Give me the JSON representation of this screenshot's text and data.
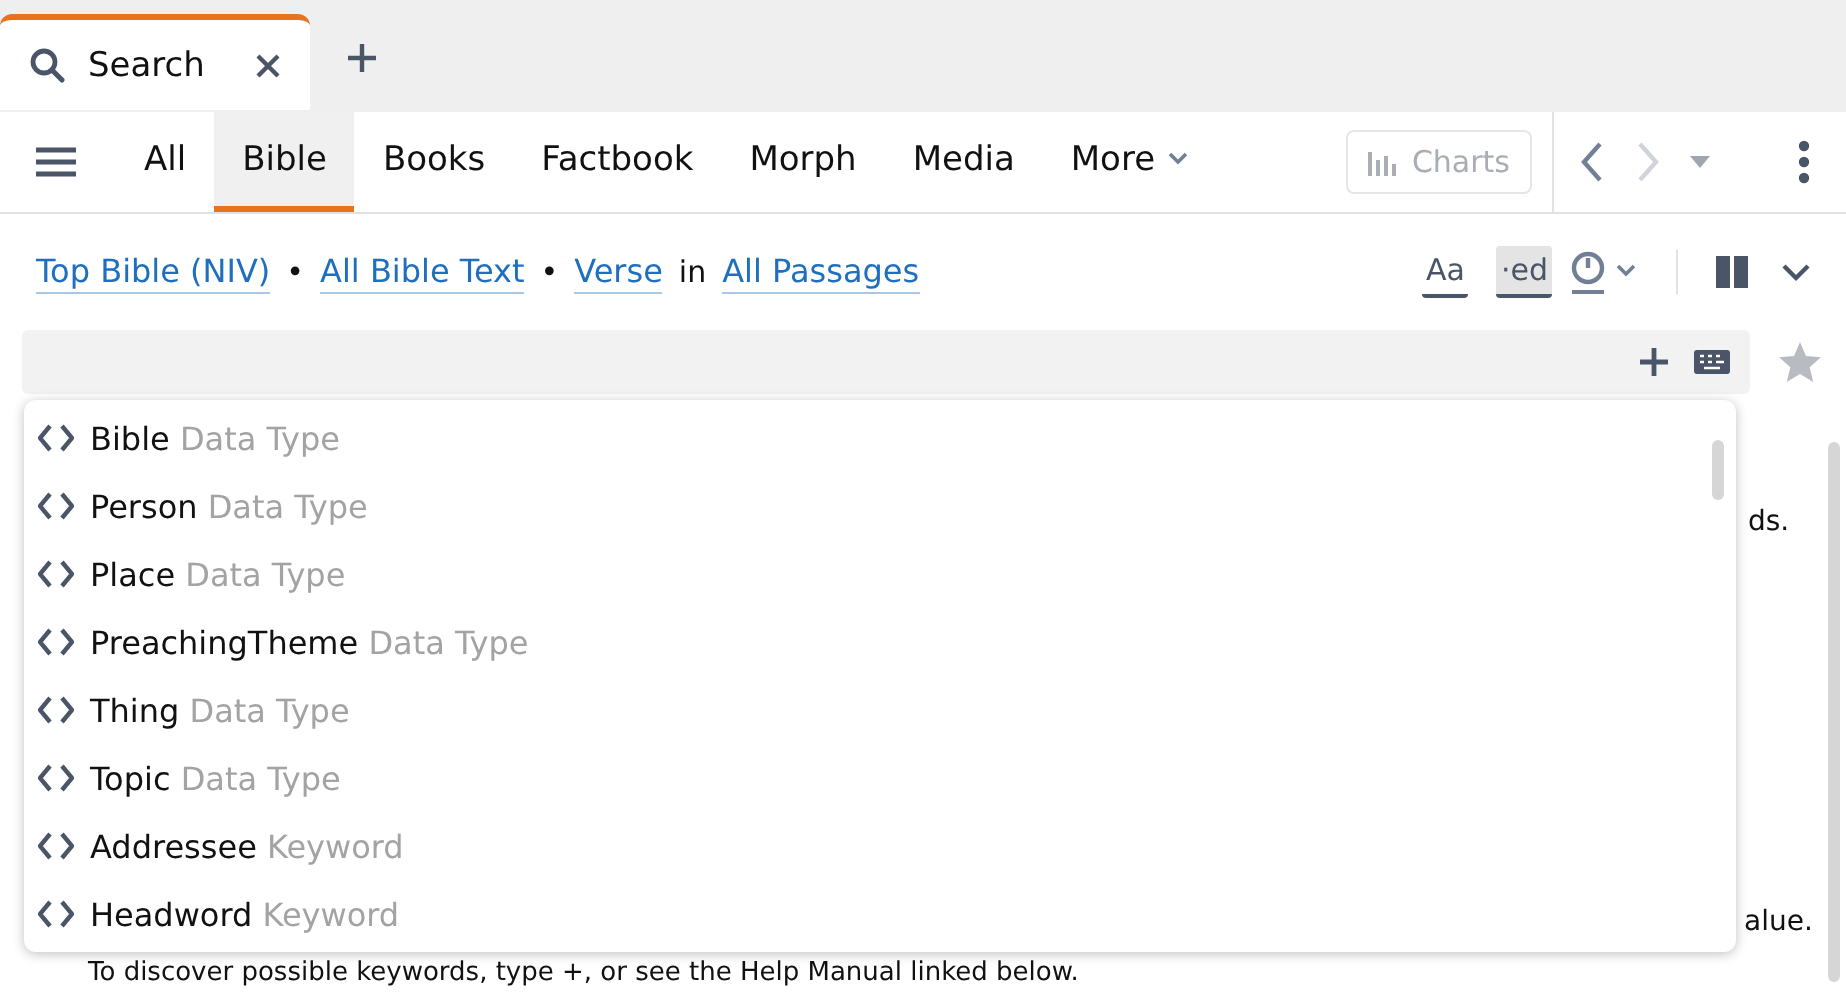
{
  "tabs": [
    {
      "label": "Search",
      "selected": true
    }
  ],
  "nav": [
    {
      "label": "All",
      "selected": false
    },
    {
      "label": "Bible",
      "selected": true
    },
    {
      "label": "Books",
      "selected": false
    },
    {
      "label": "Factbook",
      "selected": false
    },
    {
      "label": "Morph",
      "selected": false
    },
    {
      "label": "Media",
      "selected": false
    }
  ],
  "more": "More",
  "charts": {
    "label": "Charts",
    "disabled": true
  },
  "query": {
    "parts": [
      {
        "kind": "link",
        "text": "Top Bible (NIV)"
      },
      {
        "kind": "sep",
        "text": "•"
      },
      {
        "kind": "link",
        "text": "All Bible Text"
      },
      {
        "kind": "sep",
        "text": "•"
      },
      {
        "kind": "link",
        "text": "Verse"
      },
      {
        "kind": "sep",
        "text": "in"
      },
      {
        "kind": "link",
        "text": "All Passages"
      }
    ]
  },
  "tools": {
    "match_case": {
      "label": "Aa",
      "on": false
    },
    "match_all_forms": {
      "label": "·ed",
      "on": true
    }
  },
  "suggestions": [
    {
      "name": "Bible",
      "type": "Data Type"
    },
    {
      "name": "Person",
      "type": "Data Type"
    },
    {
      "name": "Place",
      "type": "Data Type"
    },
    {
      "name": "PreachingTheme",
      "type": "Data Type"
    },
    {
      "name": "Thing",
      "type": "Data Type"
    },
    {
      "name": "Topic",
      "type": "Data Type"
    },
    {
      "name": "Addressee",
      "type": "Keyword"
    },
    {
      "name": "Headword",
      "type": "Keyword"
    }
  ],
  "background": {
    "fragment_1": "ds.",
    "fragment_2": "alue.",
    "help_line": "To discover possible keywords, type +, or see the Help Manual linked below."
  }
}
